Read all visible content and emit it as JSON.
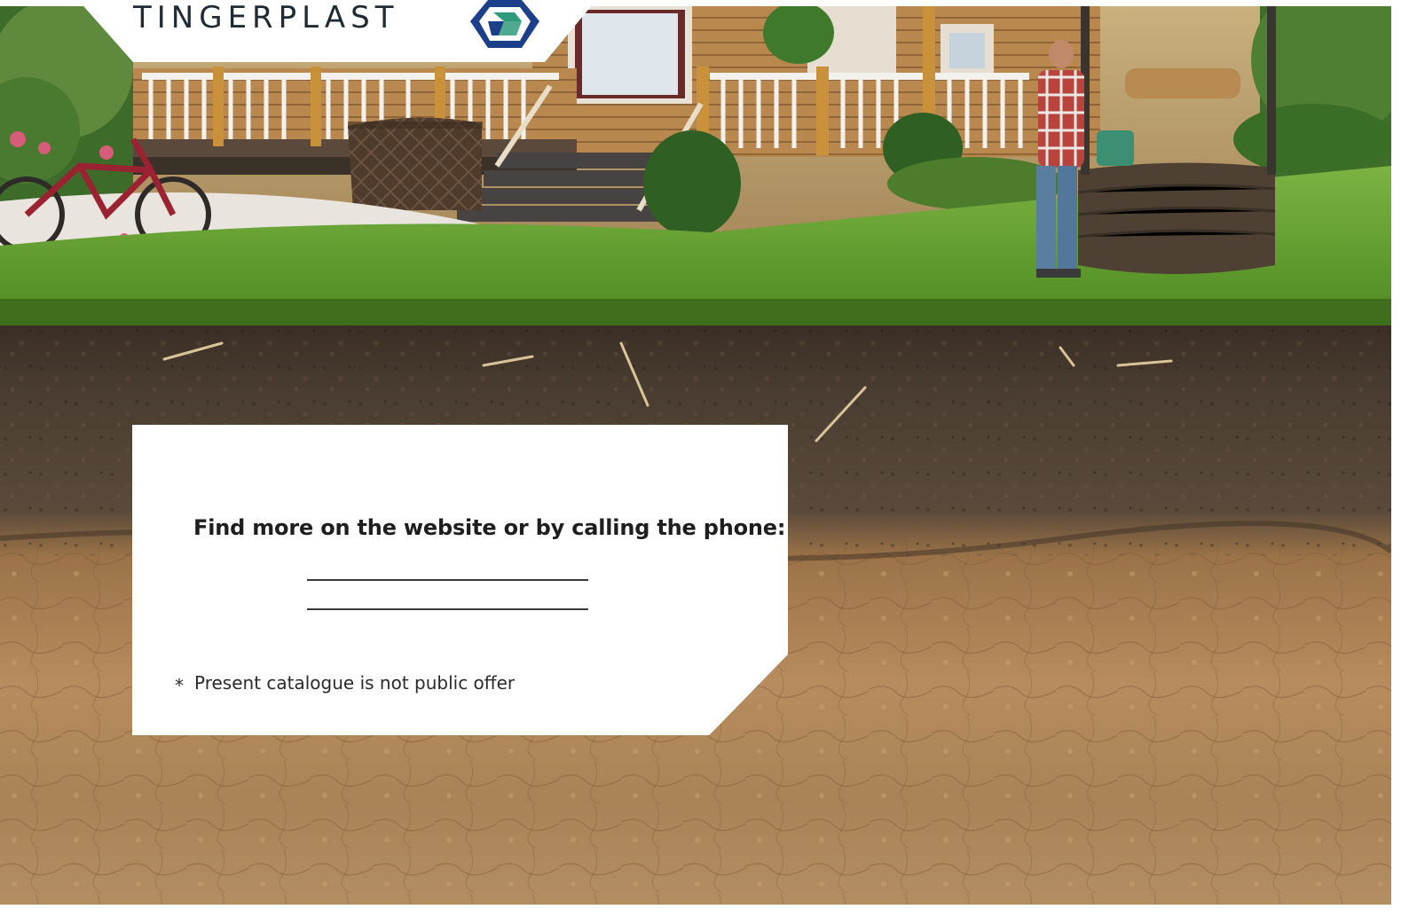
{
  "brand": {
    "name": "TINGERPLAST",
    "logo_icon": "hexagon-cube-logo",
    "colors": {
      "logo_blue": "#1c3f8a",
      "logo_green": "#2f9a7a",
      "logo_text": "#1f2a33"
    }
  },
  "scene": {
    "icon": "garden-soil-cross-section-photo"
  },
  "info": {
    "heading": "Find more on the website or by calling the phone:",
    "footnote_marker": "*",
    "footnote": "Present catalogue is not public offer"
  }
}
